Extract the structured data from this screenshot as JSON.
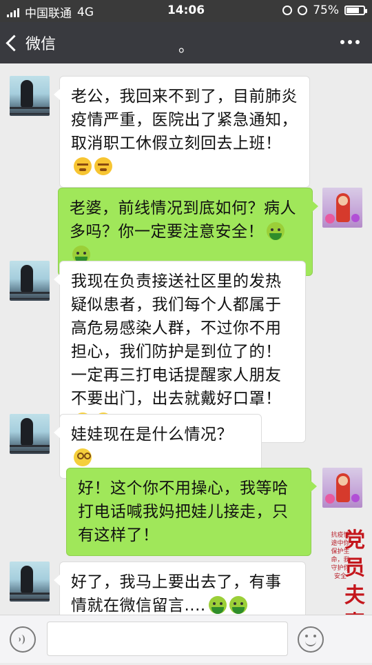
{
  "status_bar": {
    "carrier": "中国联通",
    "network": "4G",
    "time": "14:06",
    "battery": "75%",
    "battery_level": 0.75
  },
  "nav": {
    "back_label": "微信",
    "title": "。"
  },
  "messages": [
    {
      "side": "left",
      "text": "老公，我回来不到了，目前肺炎疫情严重，医院出了紧急通知，取消职工休假立刻回去上班！",
      "emoji": [
        "angry-emoji",
        "angry-emoji"
      ]
    },
    {
      "side": "right",
      "text": "老婆，前线情况到底如何？病人多吗？你一定要注意安全！",
      "emoji": [
        "green-face-emoji",
        "green-face-emoji"
      ]
    },
    {
      "side": "left",
      "text": "我现在负责接送社区里的发热疑似患者，我们每个人都属于高危易感染人群，不过你不用担心，我们防护是到位了的！一定再三打电话提醒家人朋友不要出门，出去就戴好口罩！",
      "emoji": [
        "mask-emoji",
        "mask-emoji"
      ]
    },
    {
      "side": "left",
      "text": "娃娃现在是什么情况？",
      "emoji": [
        "dizzy-emoji"
      ]
    },
    {
      "side": "right",
      "text": "好！这个你不用操心，我等哈打电话喊我妈把娃儿接走，只有这样了！",
      "emoji": []
    },
    {
      "side": "left",
      "text": "好了，我马上要出去了，有事情就在微信留言....",
      "emoji": [
        "green-face-emoji",
        "green-face-emoji"
      ]
    }
  ],
  "watermark": {
    "title": "党员夫妻档",
    "subtitle": "抗疫情途中你保护生命，我守护你安全"
  }
}
